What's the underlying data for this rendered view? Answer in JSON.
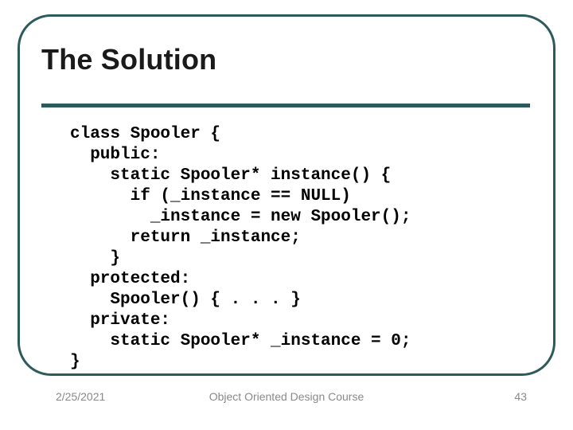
{
  "slide": {
    "title": "The Solution",
    "code": "class Spooler {\n  public:\n    static Spooler* instance() {\n      if (_instance == NULL)\n        _instance = new Spooler();\n      return _instance;\n    }\n  protected:\n    Spooler() { . . . }\n  private:\n    static Spooler* _instance = 0;\n}"
  },
  "footer": {
    "date": "2/25/2021",
    "course": "Object Oriented Design Course",
    "page": "43"
  }
}
